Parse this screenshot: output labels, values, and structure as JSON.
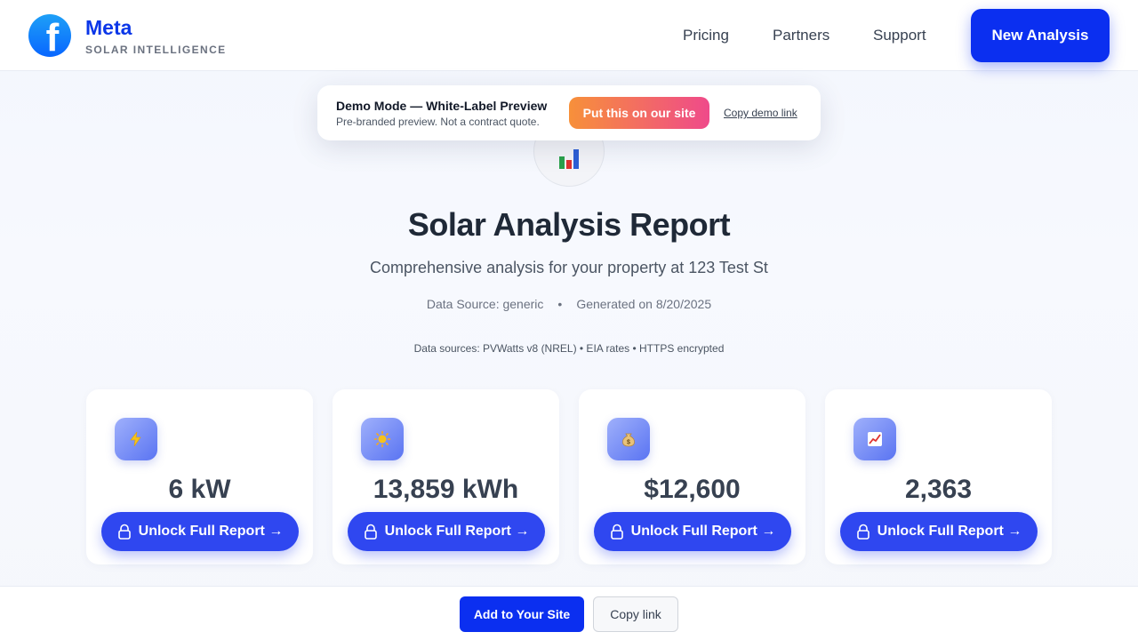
{
  "header": {
    "brand_name": "Meta",
    "brand_sub": "SOLAR INTELLIGENCE",
    "logo_letter": "f",
    "nav": [
      "Pricing",
      "Partners",
      "Support"
    ],
    "cta_label": "New Analysis"
  },
  "demo_banner": {
    "title": "Demo Mode — White-Label Preview",
    "subtitle": "Pre-branded preview. Not a contract quote.",
    "primary_label": "Put this on our site",
    "link_label": "Copy demo link"
  },
  "hero": {
    "icon": "bar-chart-icon",
    "title": "Solar Analysis Report",
    "subtitle": "Comprehensive analysis for your property at 123 Test St",
    "data_source": "Data Source: generic",
    "separator": "•",
    "generated": "Generated on 8/20/2025",
    "sources_line": "Data sources: PVWatts v8 (NREL) • EIA rates • HTTPS encrypted"
  },
  "cards": [
    {
      "icon": "lightning-icon",
      "glyph": "⚡",
      "value": "6 kW",
      "button": "Unlock Full Report →"
    },
    {
      "icon": "sun-icon",
      "glyph": "☀",
      "value": "13,859 kWh",
      "button": "Unlock Full Report →"
    },
    {
      "icon": "money-bag-icon",
      "glyph": "$",
      "value": "$12,600",
      "button": "Unlock Full Report →"
    },
    {
      "icon": "trend-chart-icon",
      "glyph": "↗",
      "value": "2,363",
      "button": "Unlock Full Report →"
    }
  ],
  "bottom_bar": {
    "add_label": "Add to Your Site",
    "copy_label": "Copy link"
  },
  "colors": {
    "brand": "#0b2ff0",
    "unlock": "#2f47f0",
    "gradient_start": "#f7903a",
    "gradient_end": "#ef4a8a"
  }
}
